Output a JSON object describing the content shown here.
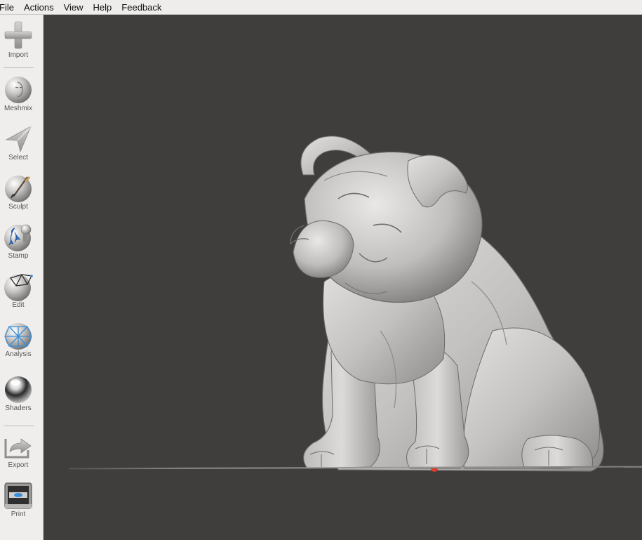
{
  "menu": [
    "File",
    "Actions",
    "View",
    "Help",
    "Feedback"
  ],
  "tools": [
    {
      "label": "Import",
      "icon": "plus-icon"
    },
    {
      "label": "Meshmix",
      "icon": "meshmix-head-icon"
    },
    {
      "label": "Select",
      "icon": "select-arrow-icon"
    },
    {
      "label": "Sculpt",
      "icon": "sculpt-brush-icon"
    },
    {
      "label": "Stamp",
      "icon": "stamp-icon"
    },
    {
      "label": "Edit",
      "icon": "edit-mesh-icon"
    },
    {
      "label": "Analysis",
      "icon": "analysis-mesh-icon"
    },
    {
      "label": "Shaders",
      "icon": "shader-sphere-icon"
    },
    {
      "label": "Export",
      "icon": "export-icon"
    },
    {
      "label": "Print",
      "icon": "printer-icon"
    }
  ],
  "colors": {
    "viewport": "#3f3e3c",
    "sidebar": "#efeeec",
    "menubar": "#eeedeb",
    "model": "#c9c8c6",
    "accent_blue": "#3a8ed8",
    "origin": "#e03a2c"
  }
}
